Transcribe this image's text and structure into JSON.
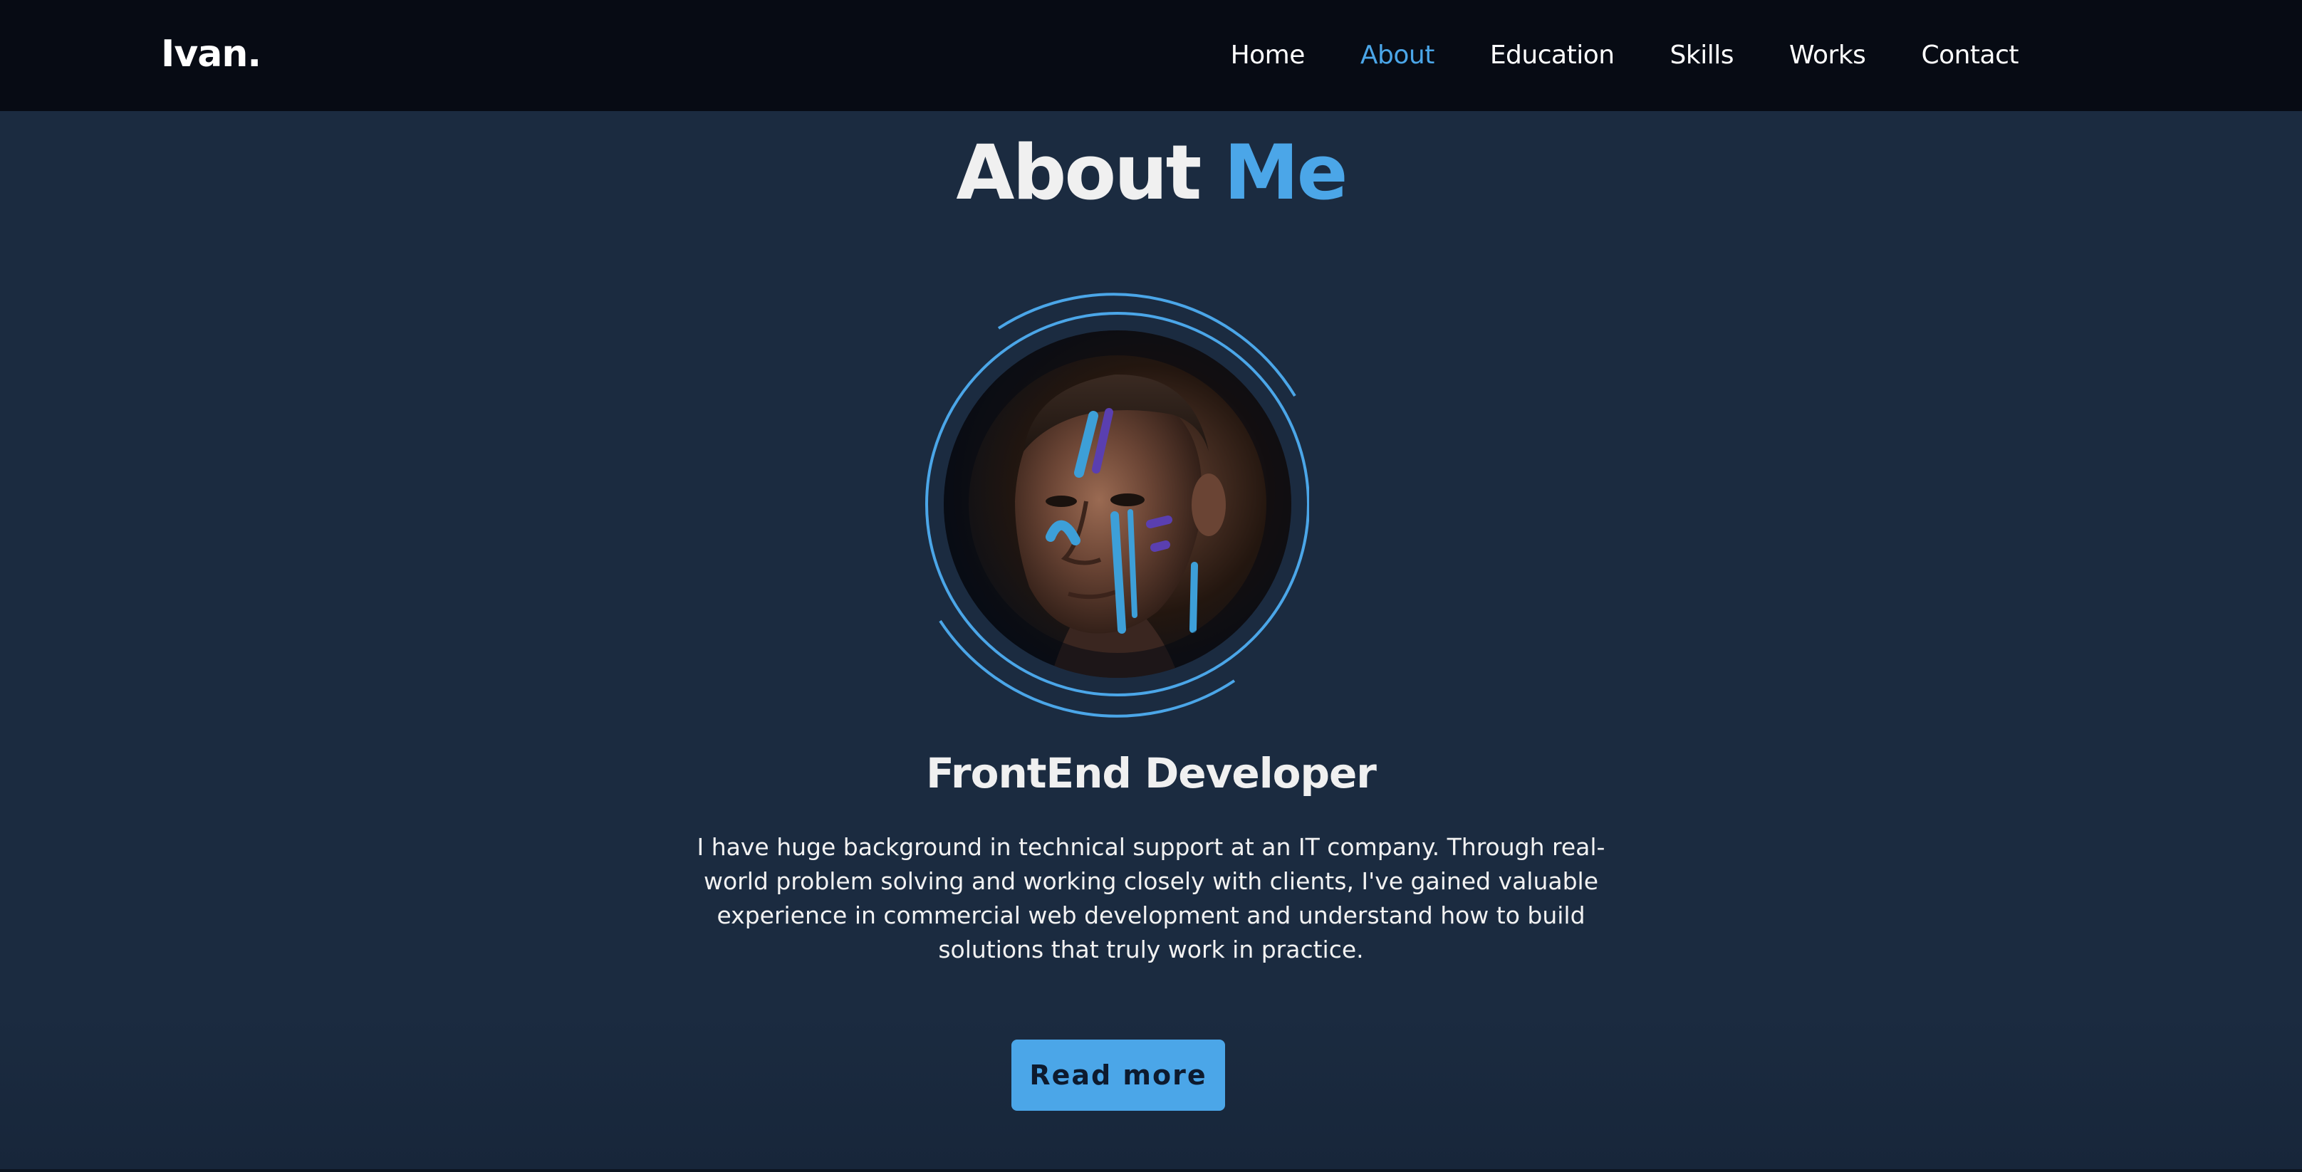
{
  "header": {
    "logo": "Ivan.",
    "nav": [
      {
        "label": "Home",
        "active": false
      },
      {
        "label": "About",
        "active": true
      },
      {
        "label": "Education",
        "active": false
      },
      {
        "label": "Skills",
        "active": false
      },
      {
        "label": "Works",
        "active": false
      },
      {
        "label": "Contact",
        "active": false
      }
    ]
  },
  "about": {
    "title_word1": "About",
    "title_word2": "Me",
    "avatar_alt": "portrait-with-face-paint",
    "role": "FrontEnd Developer",
    "description": "I have huge background in technical support at an IT company. Through real-world problem solving and working closely with clients, I've gained valuable experience in commercial web development and understand how to build solutions that truly work in practice.",
    "button_label": "Read more"
  },
  "colors": {
    "accent": "#4ba6e8",
    "background": "#1b2b40",
    "header_bg": "#070b14",
    "text": "#ffffff"
  }
}
